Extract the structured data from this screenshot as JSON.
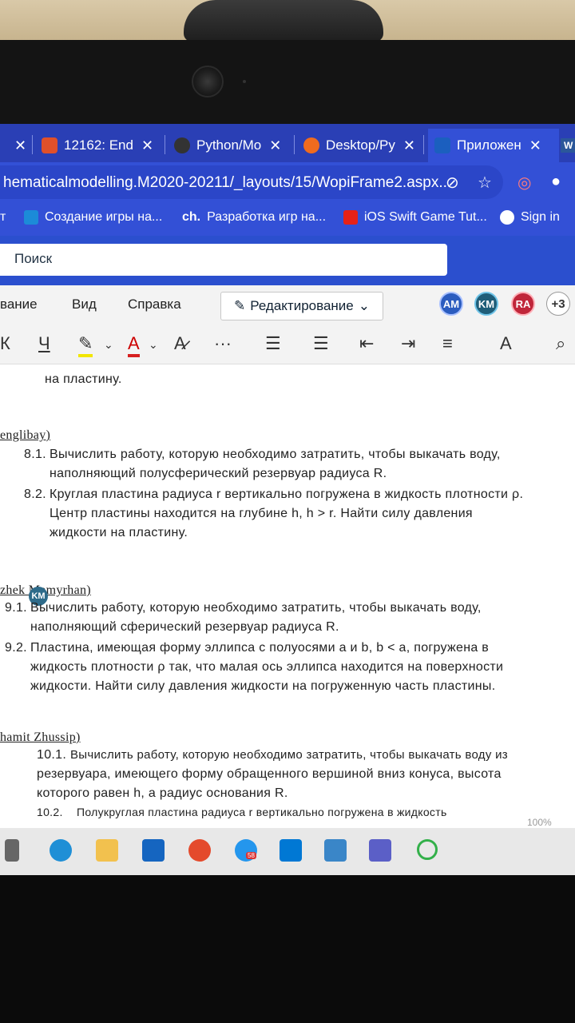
{
  "browser": {
    "tabs": [
      {
        "label": "12162: End",
        "icon_color": "#e0502a"
      },
      {
        "label": "Python/Mo",
        "icon_color": "#333333"
      },
      {
        "label": "Desktop/Py",
        "icon_color": "#f06b1e"
      },
      {
        "label": "Приложен",
        "icon_color": "#1b5fbf"
      }
    ],
    "last_tab_label": "W",
    "close_glyph": "✕",
    "address": "hematicalmodelling.M2020-20211/_layouts/15/WopiFrame2.aspx..."
  },
  "bookmarks": [
    {
      "label": "Создание игры на...",
      "prefix": "т"
    },
    {
      "label": "Разработка игр на...",
      "prefix": "ch."
    },
    {
      "label": "iOS Swift Game Tut..."
    },
    {
      "label": "Sign in"
    }
  ],
  "office": {
    "search_placeholder": "Поиск",
    "menu": [
      "вание",
      "Вид",
      "Справка"
    ],
    "edit_mode_label": "Редактирование",
    "avatars": [
      {
        "initials": "AM",
        "color": "#2b5cbf"
      },
      {
        "initials": "KM",
        "color": "#1f5d78"
      },
      {
        "initials": "RA",
        "color": "#c0263a"
      }
    ],
    "more_collaborators": "+3",
    "toolbar": {
      "italic": "К",
      "underline": "Ч",
      "font_color": "A",
      "more": "···"
    }
  },
  "document": {
    "prev_end": "на пластину.",
    "sections": [
      {
        "header": "englibay)",
        "items": [
          {
            "num": "8.1.",
            "lines": [
              "Вычислить работу, которую необходимо затратить, чтобы выкачать воду,",
              "наполняющий полусферический резервуар радиуса R."
            ]
          },
          {
            "num": "8.2.",
            "lines": [
              "Круглая пластина радиуса r вертикально погружена в жидкость плотности ρ.",
              "Центр пластины находится на глубине h, h > r. Найти силу давления",
              "жидкости на пластину."
            ]
          }
        ]
      },
      {
        "header": "zhek   Mamyrhan)",
        "items": [
          {
            "num": "9.1.",
            "lines": [
              "Вычислить работу, которую необходимо затратить, чтобы выкачать воду,",
              "наполняющий сферический резервуар радиуса R."
            ]
          },
          {
            "num": "9.2.",
            "lines": [
              "Пластина, имеющая форму эллипса с полуосями a и b, b < a, погружена в",
              "жидкость плотности ρ так, что малая ось эллипса находится на поверхности",
              "жидкости. Найти силу давления жидкости на погруженную часть пластины."
            ]
          }
        ]
      },
      {
        "header": "hamit Zhussip)",
        "items": [
          {
            "num": "10.1.",
            "lines": [
              "Вычислить работу, которую необходимо затратить, чтобы выкачать воду из",
              "резервуара, имеющего форму обращенного вершиной вниз конуса, высота",
              "которого равен h, а радиус основания R."
            ]
          },
          {
            "num": "10.2.",
            "lines": [
              "Полукруглая пластина радиуса r вертикально погружена в жидкость"
            ]
          }
        ]
      }
    ],
    "cursor_badge": "KM",
    "zoom": "100%"
  },
  "taskbar": {
    "badge": "58"
  }
}
